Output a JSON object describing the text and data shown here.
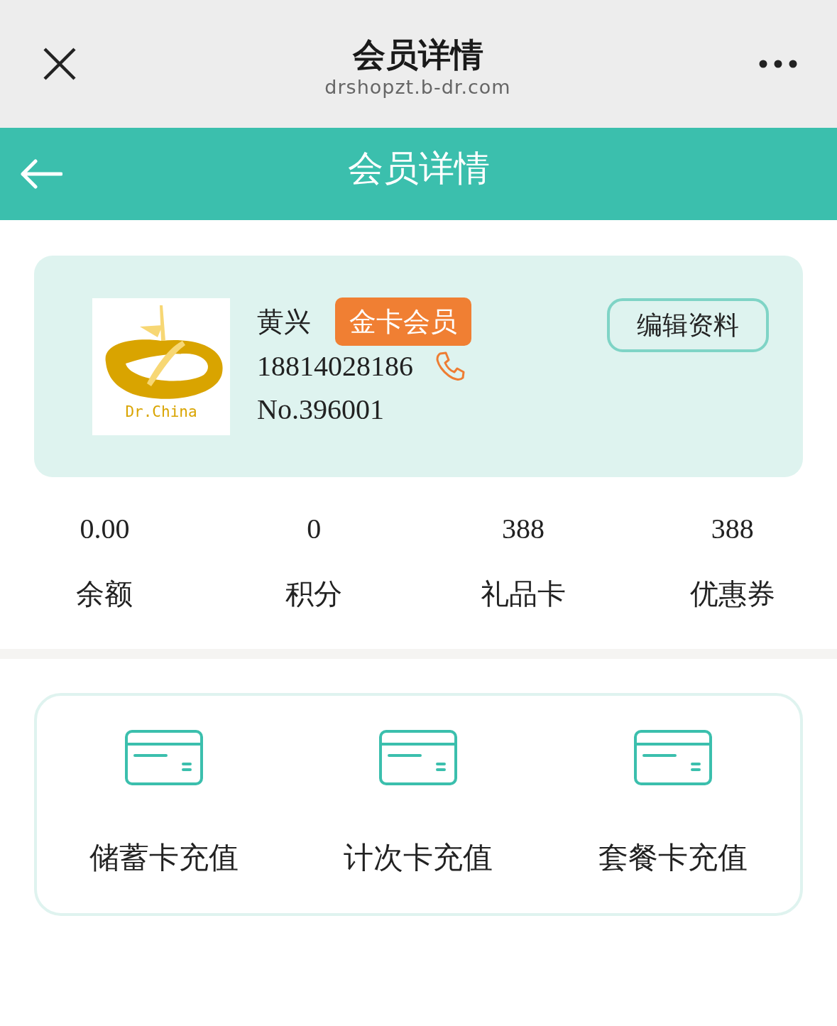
{
  "browser_bar": {
    "title": "会员详情",
    "url": "drshopzt.b-dr.com"
  },
  "header": {
    "title": "会员详情"
  },
  "member": {
    "logo_text": "Dr.China",
    "name": "黄兴",
    "badge": "金卡会员",
    "phone": "18814028186",
    "number": "No.396001",
    "edit_button": "编辑资料"
  },
  "stats": [
    {
      "value": "0.00",
      "label": "余额"
    },
    {
      "value": "0",
      "label": "积分"
    },
    {
      "value": "388",
      "label": "礼品卡"
    },
    {
      "value": "388",
      "label": "优惠券"
    }
  ],
  "actions": [
    {
      "label": "储蓄卡充值"
    },
    {
      "label": "计次卡充值"
    },
    {
      "label": "套餐卡充值"
    }
  ]
}
